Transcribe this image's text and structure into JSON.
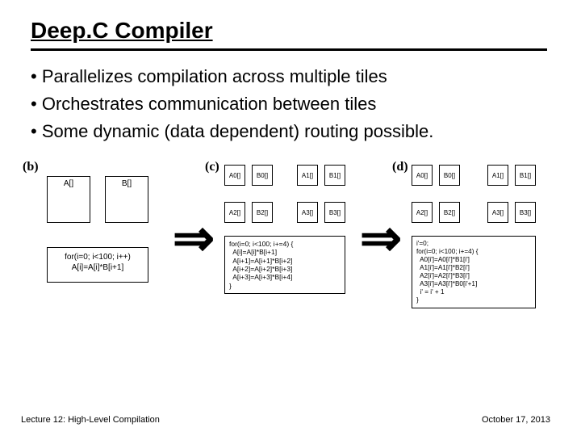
{
  "title": "Deep.C Compiler",
  "bullets": [
    "Parallelizes compilation across multiple tiles",
    "Orchestrates communication between tiles",
    "Some dynamic (data dependent) routing possible."
  ],
  "panels": {
    "b": {
      "label": "(b)",
      "A": "A[]",
      "B": "B[]",
      "loop": [
        "for(i=0; i<100; i++)",
        "A[i]=A[i]*B[i+1]"
      ]
    },
    "arrow": "⇒",
    "c": {
      "label": "(c)",
      "cells": {
        "A0": "A0[]",
        "B0": "B0[]",
        "A1": "A1[]",
        "B1": "B1[]",
        "A2": "A2[]",
        "B2": "B2[]",
        "A3": "A3[]",
        "B3": "B3[]"
      },
      "loop": [
        "for(i=0; i<100; i+=4) {",
        "  A[i]=A[i]*B[i+1]",
        "  A[i+1]=A[i+1]*B[i+2]",
        "  A[i+2]=A[i+2]*B[i+3]",
        "  A[i+3]=A[i+3]*B[i+4]",
        "}"
      ]
    },
    "d": {
      "label": "(d)",
      "cells": {
        "A0": "A0[]",
        "B0": "B0[]",
        "A1": "A1[]",
        "B1": "B1[]",
        "A2": "A2[]",
        "B2": "B2[]",
        "A3": "A3[]",
        "B3": "B3[]"
      },
      "loop": [
        "i'=0;",
        "for(i=0; i<100; i+=4) {",
        "  A0[i']=A0[i']*B1[i']",
        "  A1[i']=A1[i']*B2[i']",
        "  A2[i']=A2[i']*B3[i']",
        "  A3[i']=A3[i']*B0[i'+1]",
        "  i' = i' + 1",
        "}"
      ]
    }
  },
  "footer": {
    "left": "Lecture 12: High-Level Compilation",
    "right": "October 17, 2013"
  }
}
